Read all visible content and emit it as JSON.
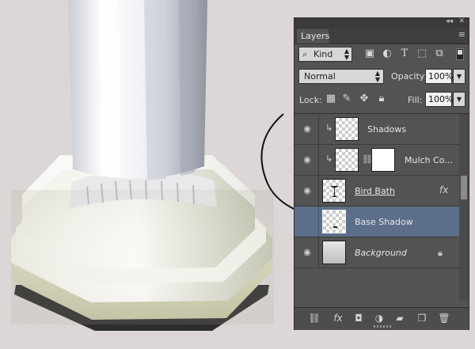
{
  "panel": {
    "collapse_glyph": "◂◂",
    "close_glyph": "✕",
    "tab": "Layers",
    "menu_glyph": "≡",
    "filter": {
      "kind": "Kind",
      "search_icon": "search-icon"
    },
    "filter_icons": [
      "image-filter-icon",
      "adjustment-filter-icon",
      "type-filter-icon",
      "shape-filter-icon",
      "smartobject-filter-icon"
    ],
    "blend_mode": "Normal",
    "opacity_label": "Opacity:",
    "opacity_value": "100%",
    "lock_label": "Lock:",
    "lock_icons": [
      "lock-transparent-icon",
      "lock-image-icon",
      "lock-position-icon",
      "lock-all-icon"
    ],
    "fill_label": "Fill:",
    "fill_value": "100%",
    "layers": [
      {
        "name": "Shadows",
        "clipped": true,
        "thumb": "transparent",
        "selected": false
      },
      {
        "name": "Mulch Co...",
        "clipped": true,
        "thumb": "transparent",
        "mask": true,
        "selected": false
      },
      {
        "name": "Bird Bath",
        "clipped": false,
        "thumb": "birdbath",
        "fx": "fx",
        "selected": false
      },
      {
        "name": "Base Shadow",
        "clipped": false,
        "thumb": "transparent",
        "selected": true
      },
      {
        "name": "Background",
        "clipped": false,
        "thumb": "grey",
        "locked": true,
        "selected": false
      }
    ],
    "bottom_icons": [
      "link-layers-icon",
      "fx-icon",
      "add-mask-icon",
      "adjustment-layer-icon",
      "new-group-icon",
      "new-layer-icon",
      "delete-icon"
    ]
  },
  "colors": {
    "panel_bg": "#535353",
    "selected_row": "#5c6e8a",
    "canvas_bg": "#dcd6d6"
  }
}
